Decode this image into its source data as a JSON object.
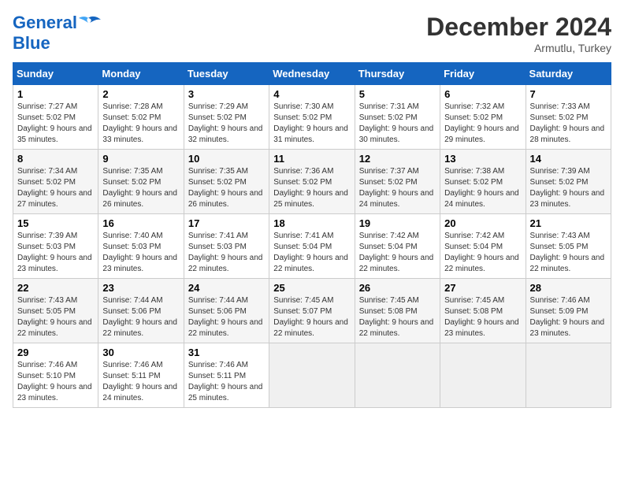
{
  "header": {
    "logo_line1": "General",
    "logo_line2": "Blue",
    "month": "December 2024",
    "location": "Armutlu, Turkey"
  },
  "columns": [
    "Sunday",
    "Monday",
    "Tuesday",
    "Wednesday",
    "Thursday",
    "Friday",
    "Saturday"
  ],
  "weeks": [
    [
      {
        "day": "1",
        "sunrise": "7:27 AM",
        "sunset": "5:02 PM",
        "daylight": "9 hours and 35 minutes."
      },
      {
        "day": "2",
        "sunrise": "7:28 AM",
        "sunset": "5:02 PM",
        "daylight": "9 hours and 33 minutes."
      },
      {
        "day": "3",
        "sunrise": "7:29 AM",
        "sunset": "5:02 PM",
        "daylight": "9 hours and 32 minutes."
      },
      {
        "day": "4",
        "sunrise": "7:30 AM",
        "sunset": "5:02 PM",
        "daylight": "9 hours and 31 minutes."
      },
      {
        "day": "5",
        "sunrise": "7:31 AM",
        "sunset": "5:02 PM",
        "daylight": "9 hours and 30 minutes."
      },
      {
        "day": "6",
        "sunrise": "7:32 AM",
        "sunset": "5:02 PM",
        "daylight": "9 hours and 29 minutes."
      },
      {
        "day": "7",
        "sunrise": "7:33 AM",
        "sunset": "5:02 PM",
        "daylight": "9 hours and 28 minutes."
      }
    ],
    [
      {
        "day": "8",
        "sunrise": "7:34 AM",
        "sunset": "5:02 PM",
        "daylight": "9 hours and 27 minutes."
      },
      {
        "day": "9",
        "sunrise": "7:35 AM",
        "sunset": "5:02 PM",
        "daylight": "9 hours and 26 minutes."
      },
      {
        "day": "10",
        "sunrise": "7:35 AM",
        "sunset": "5:02 PM",
        "daylight": "9 hours and 26 minutes."
      },
      {
        "day": "11",
        "sunrise": "7:36 AM",
        "sunset": "5:02 PM",
        "daylight": "9 hours and 25 minutes."
      },
      {
        "day": "12",
        "sunrise": "7:37 AM",
        "sunset": "5:02 PM",
        "daylight": "9 hours and 24 minutes."
      },
      {
        "day": "13",
        "sunrise": "7:38 AM",
        "sunset": "5:02 PM",
        "daylight": "9 hours and 24 minutes."
      },
      {
        "day": "14",
        "sunrise": "7:39 AM",
        "sunset": "5:02 PM",
        "daylight": "9 hours and 23 minutes."
      }
    ],
    [
      {
        "day": "15",
        "sunrise": "7:39 AM",
        "sunset": "5:03 PM",
        "daylight": "9 hours and 23 minutes."
      },
      {
        "day": "16",
        "sunrise": "7:40 AM",
        "sunset": "5:03 PM",
        "daylight": "9 hours and 23 minutes."
      },
      {
        "day": "17",
        "sunrise": "7:41 AM",
        "sunset": "5:03 PM",
        "daylight": "9 hours and 22 minutes."
      },
      {
        "day": "18",
        "sunrise": "7:41 AM",
        "sunset": "5:04 PM",
        "daylight": "9 hours and 22 minutes."
      },
      {
        "day": "19",
        "sunrise": "7:42 AM",
        "sunset": "5:04 PM",
        "daylight": "9 hours and 22 minutes."
      },
      {
        "day": "20",
        "sunrise": "7:42 AM",
        "sunset": "5:04 PM",
        "daylight": "9 hours and 22 minutes."
      },
      {
        "day": "21",
        "sunrise": "7:43 AM",
        "sunset": "5:05 PM",
        "daylight": "9 hours and 22 minutes."
      }
    ],
    [
      {
        "day": "22",
        "sunrise": "7:43 AM",
        "sunset": "5:05 PM",
        "daylight": "9 hours and 22 minutes."
      },
      {
        "day": "23",
        "sunrise": "7:44 AM",
        "sunset": "5:06 PM",
        "daylight": "9 hours and 22 minutes."
      },
      {
        "day": "24",
        "sunrise": "7:44 AM",
        "sunset": "5:06 PM",
        "daylight": "9 hours and 22 minutes."
      },
      {
        "day": "25",
        "sunrise": "7:45 AM",
        "sunset": "5:07 PM",
        "daylight": "9 hours and 22 minutes."
      },
      {
        "day": "26",
        "sunrise": "7:45 AM",
        "sunset": "5:08 PM",
        "daylight": "9 hours and 22 minutes."
      },
      {
        "day": "27",
        "sunrise": "7:45 AM",
        "sunset": "5:08 PM",
        "daylight": "9 hours and 23 minutes."
      },
      {
        "day": "28",
        "sunrise": "7:46 AM",
        "sunset": "5:09 PM",
        "daylight": "9 hours and 23 minutes."
      }
    ],
    [
      {
        "day": "29",
        "sunrise": "7:46 AM",
        "sunset": "5:10 PM",
        "daylight": "9 hours and 23 minutes."
      },
      {
        "day": "30",
        "sunrise": "7:46 AM",
        "sunset": "5:11 PM",
        "daylight": "9 hours and 24 minutes."
      },
      {
        "day": "31",
        "sunrise": "7:46 AM",
        "sunset": "5:11 PM",
        "daylight": "9 hours and 25 minutes."
      },
      null,
      null,
      null,
      null
    ]
  ],
  "labels": {
    "sunrise": "Sunrise:",
    "sunset": "Sunset:",
    "daylight": "Daylight:"
  }
}
